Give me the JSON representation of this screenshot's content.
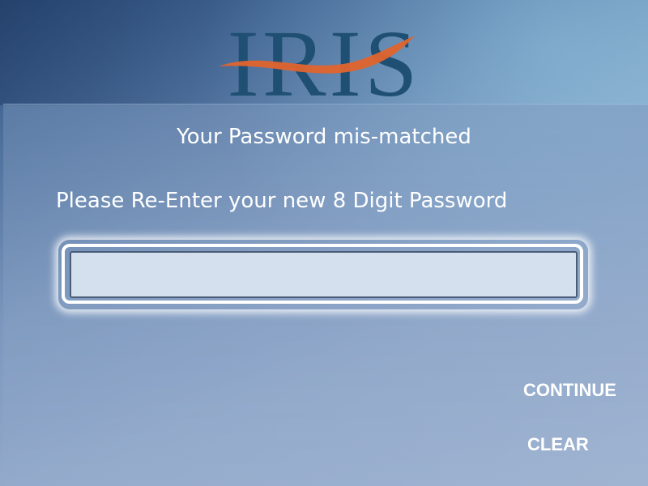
{
  "branding": {
    "logo_text": "IRIS",
    "logo_color": "#1f4f72",
    "swoosh_color": "#e0642d"
  },
  "message": {
    "title": "Your Password mis-matched",
    "prompt": "Please Re-Enter your new 8 Digit Password"
  },
  "password_field": {
    "value": "",
    "placeholder": ""
  },
  "actions": {
    "continue_label": "CONTINUE",
    "clear_label": "CLEAR"
  }
}
